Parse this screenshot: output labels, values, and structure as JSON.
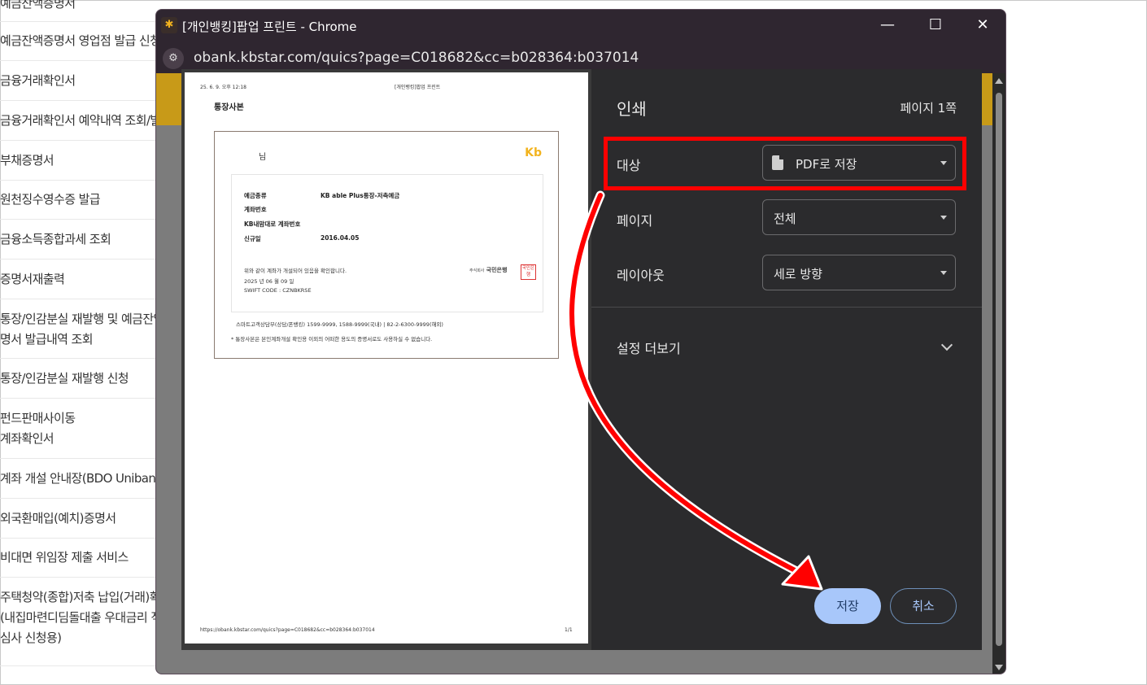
{
  "background_list": [
    {
      "lines": [
        "예금잔액증명서"
      ]
    },
    {
      "lines": [
        "예금잔액증명서 영업점 발급 신청"
      ]
    },
    {
      "lines": [
        "금융거래확인서"
      ]
    },
    {
      "lines": [
        "금융거래확인서 예약내역 조회/발"
      ]
    },
    {
      "lines": [
        "부채증명서"
      ]
    },
    {
      "lines": [
        "원천징수영수증 발급"
      ]
    },
    {
      "lines": [
        "금융소득종합과세 조회"
      ]
    },
    {
      "lines": [
        "증명서재출력"
      ]
    },
    {
      "lines": [
        "통장/인감분실 재발행 및 예금잔액",
        "명서 발급내역 조회"
      ]
    },
    {
      "lines": [
        "통장/인감분실 재발행 신청"
      ]
    },
    {
      "lines": [
        "펀드판매사이동",
        "계좌확인서"
      ]
    },
    {
      "lines": [
        "계좌 개설 안내장(BDO Unibank)"
      ]
    },
    {
      "lines": [
        "외국환매입(예치)증명서"
      ]
    },
    {
      "lines": [
        "비대면 위임장 제출 서비스"
      ]
    },
    {
      "lines": [
        "주택청약(종합)저축 납입(거래)확",
        "(내집마련디딤돌대출 우대금리 적",
        "심사 신청용)"
      ]
    }
  ],
  "window": {
    "title": "[개인뱅킹]팝업 프린트 - Chrome",
    "url": "obank.kbstar.com/quics?page=C018682&cc=b028364:b037014",
    "controls": {
      "minimize": "—",
      "maximize": "☐",
      "close": "✕"
    }
  },
  "preview": {
    "header_left": "25. 6. 9. 오후 12:18",
    "header_center": "[개인뱅킹]팝업 프린트",
    "doc_title": "통장사본",
    "holder_suffix": "님",
    "kb_logo": "Kb",
    "fields": [
      {
        "label": "예금종류",
        "value": "KB able Plus통장-저축예금"
      },
      {
        "label": "계좌번호",
        "value": ""
      },
      {
        "label": "KB내맘대로 계좌번호",
        "value": ""
      },
      {
        "label": "신규일",
        "value": "2016.04.05"
      }
    ],
    "confirm_text": "위와 같이 계좌가 개설되어 있음을 확인합니다.",
    "confirm_date": "2025 년 06 월 09 일",
    "swift": "SWIFT CODE : CZNBKRSE",
    "bank_name_small": "주식회사",
    "bank_name": "국민은행",
    "seal_text": "국민은행",
    "contact": "스마트고객상담부(상담/폰뱅킹) 1599-9999, 1588-9999(국내) | 82-2-6300-9999(해외)",
    "disclaimer": "* 통장사본은 본인계좌개설 확인용 이외의 어떠한 용도의 증명서로도 사용하실 수 없습니다.",
    "footer_url": "https://obank.kbstar.com/quics?page=C018682&cc=b028364:b037014",
    "footer_page": "1/1"
  },
  "print_settings": {
    "title": "인쇄",
    "page_count": "페이지 1쪽",
    "destination": {
      "label": "대상",
      "value": "PDF로 저장"
    },
    "pages": {
      "label": "페이지",
      "value": "전체"
    },
    "layout": {
      "label": "레이아웃",
      "value": "세로 방향"
    },
    "more_settings": "설정 더보기",
    "save_button": "저장",
    "cancel_button": "취소"
  },
  "colors": {
    "annotation": "#ff0000",
    "kb_gold": "#f2b31e",
    "save_button_bg": "#a8c7fa",
    "panel_bg": "#2b2b2d",
    "titlebar_bg": "#2f2630"
  }
}
